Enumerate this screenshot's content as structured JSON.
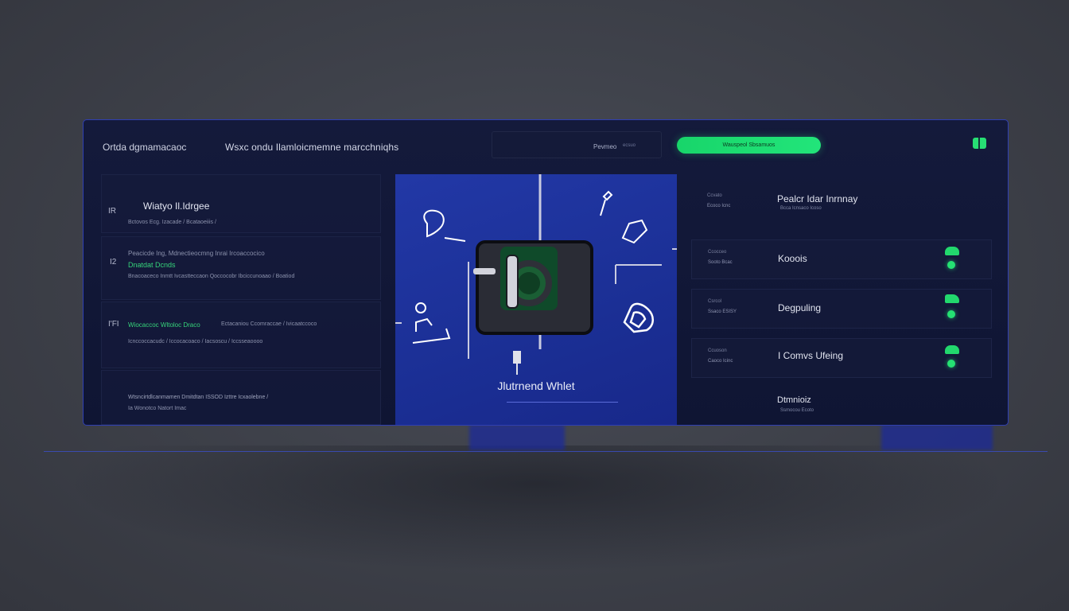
{
  "header": {
    "app_title": "Ortda dgmamacaoc",
    "subtitle": "Wsxc ondu Ilamloicmemne marcchniqhs",
    "filter_label": "Pevmeo",
    "filter_small": "ecsuo",
    "cta_label": "Wauspeol Sbsamuos"
  },
  "left_panel": {
    "card1": {
      "mark": "IR",
      "title": "Wiatyo Il.Idrgee",
      "meta": "Bctovos Ecg. Izacade /    Bcataoeiiis /"
    },
    "card2": {
      "mark": "I2",
      "line1": "Peacicde Ing, Mdnectieocmng Inrai Ircoaccocico",
      "green": "Dnatdat Dcnds",
      "meta": "Bnacoaceco Inmtt     Ivcastteccaon    Qoccocobr    Ibciccunoaao / Boatiod"
    },
    "card3": {
      "mark": "I'FI",
      "green": "Wiocaccoc Wltoloc Draco",
      "line1": "Ectacaniou Ccomraccae /    Ivicaatccoco",
      "meta": "Icnccoccacudc /    Iccocacoaco /    Iacsoscu /    Iccsseaoooo"
    },
    "card4": {
      "line1": "Wtsncirtdlcanmamen Dmitdtan ISSOD Izttre Icxaolebne /",
      "line2": "Ia Wonotco Natort  Imac"
    }
  },
  "center": {
    "wallet_label": "Jlutrnend Whlet"
  },
  "right_panel": {
    "rows": [
      {
        "mini1": "Ccvato",
        "mini2": "Ecoco  Icnc",
        "label": "Pealcr Idar Inrnnay",
        "sub": "Bcca  Icnsaco  Icoso",
        "status": "none"
      },
      {
        "mini1": "Ccocceo",
        "mini2": "Sooto  Bcac",
        "label": "Kooois",
        "sub": "",
        "status": "active"
      },
      {
        "mini1": "Csrcol",
        "mini2": "Ssaco  ESISY",
        "label": "Degpuling",
        "sub": "",
        "status": "active"
      },
      {
        "mini1": "Ccuoson",
        "mini2": "Caoco  Icinc",
        "label": "I Comvs Ufeing",
        "sub": "",
        "status": "active"
      },
      {
        "mini1": "",
        "mini2": "",
        "label": "Dtmnioiz",
        "sub": "Ssmocou Ecoto",
        "status": "none"
      }
    ]
  },
  "colors": {
    "accent_green": "#22e57a",
    "panel_bg": "#12183a",
    "center_blue": "#1f34a0",
    "border_blue": "#2f3fb3"
  },
  "icons": [
    "wallet-icon",
    "chat-bubble-icon",
    "key-icon",
    "hand-bag-icon",
    "shield-icon",
    "user-desk-icon",
    "plug-icon",
    "toggle-icon"
  ]
}
